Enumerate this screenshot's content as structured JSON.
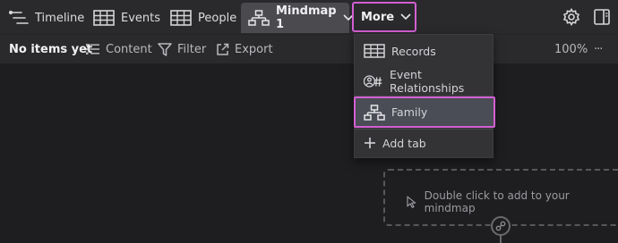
{
  "tabs": {
    "timeline": "Timeline",
    "events": "Events",
    "people": "People",
    "mindmap": "Mindmap 1",
    "more": "More"
  },
  "toolbar": {
    "status": "No items yet",
    "content": "Content",
    "filter": "Filter",
    "export": "Export",
    "zoom": "100%",
    "overflow": "···"
  },
  "menu": {
    "items": [
      "Records",
      "Event Relationships",
      "Family"
    ],
    "add_tab": "Add tab"
  },
  "canvas": {
    "hint": "Double click to add to your mindmap"
  },
  "colors": {
    "highlight": "#d35fd3",
    "background": "#1e1e20",
    "bar": "#2a2a2d"
  }
}
